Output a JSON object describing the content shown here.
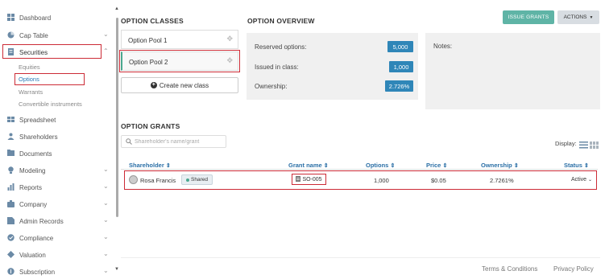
{
  "sidebar": {
    "items": [
      {
        "label": "Dashboard",
        "icon": "dashboard-icon",
        "chevron": false
      },
      {
        "label": "Cap Table",
        "icon": "cap-table-icon",
        "chevron": true
      },
      {
        "label": "Securities",
        "icon": "securities-icon",
        "chevron": true
      },
      {
        "label": "Spreadsheet",
        "icon": "spreadsheet-icon",
        "chevron": false
      },
      {
        "label": "Shareholders",
        "icon": "shareholders-icon",
        "chevron": false
      },
      {
        "label": "Documents",
        "icon": "documents-icon",
        "chevron": false
      },
      {
        "label": "Modeling",
        "icon": "modeling-icon",
        "chevron": true
      },
      {
        "label": "Reports",
        "icon": "reports-icon",
        "chevron": true
      },
      {
        "label": "Company",
        "icon": "company-icon",
        "chevron": true
      },
      {
        "label": "Admin Records",
        "icon": "admin-records-icon",
        "chevron": true
      },
      {
        "label": "Compliance",
        "icon": "compliance-icon",
        "chevron": true
      },
      {
        "label": "Valuation",
        "icon": "valuation-icon",
        "chevron": true
      },
      {
        "label": "Subscription",
        "icon": "subscription-icon",
        "chevron": true
      }
    ],
    "securities_sub": [
      "Equities",
      "Options",
      "Warrants",
      "Convertible instruments"
    ]
  },
  "option_classes": {
    "title": "OPTION CLASSES",
    "items": [
      "Option Pool 1",
      "Option Pool 2"
    ],
    "create_label": "Create new class"
  },
  "overview": {
    "title": "OPTION OVERVIEW",
    "rows": [
      {
        "label": "Reserved options:",
        "value": "5,000"
      },
      {
        "label": "Issued in class:",
        "value": "1,000"
      },
      {
        "label": "Ownership:",
        "value": "2.726%"
      }
    ],
    "notes_label": "Notes:"
  },
  "toolbar": {
    "issue_label": "ISSUE GRANTS",
    "actions_label": "ACTIONS"
  },
  "grants": {
    "title": "OPTION GRANTS",
    "search_placeholder": "Shareholder's name/grant",
    "display_label": "Display:",
    "columns": [
      "Shareholder",
      "Grant name",
      "Options",
      "Price",
      "Ownership",
      "Status"
    ],
    "rows": [
      {
        "shareholder": "Rosa Francis",
        "badge": "Shared",
        "grant": "SO-005",
        "options": "1,000",
        "price": "$0.05",
        "ownership": "2.7261%",
        "status": "Active"
      }
    ]
  },
  "footer": {
    "terms": "Terms & Conditions",
    "privacy": "Privacy Policy"
  },
  "colors": {
    "accent": "#2f86b8",
    "issue_button": "#5fb4a6",
    "highlight": "#cc2b36"
  }
}
